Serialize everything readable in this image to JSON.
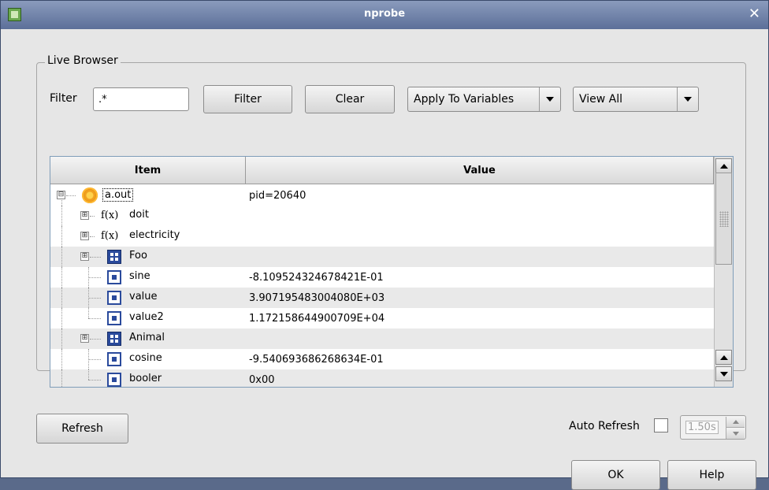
{
  "window": {
    "title": "nprobe",
    "close_glyph": "✕",
    "app_icon": "nprobe-app-icon"
  },
  "group": {
    "legend": "Live Browser"
  },
  "filter": {
    "label": "Filter",
    "value": ".*",
    "filter_button": "Filter",
    "clear_button": "Clear",
    "apply_combo": "Apply To Variables",
    "view_combo": "View All"
  },
  "tree": {
    "columns": [
      "Item",
      "Value"
    ],
    "rows": [
      {
        "label": "a.out",
        "value": "pid=20640",
        "icon": "process-gear-icon",
        "expander": "⊟"
      },
      {
        "label": "doit",
        "value": "",
        "icon": "function-icon",
        "icon_text": "f(x)",
        "expander": "⊞"
      },
      {
        "label": "electricity",
        "value": "",
        "icon": "function-icon",
        "icon_text": "f(x)",
        "expander": "⊞"
      },
      {
        "label": "Foo",
        "value": "",
        "icon": "struct-icon",
        "expander": "⊞"
      },
      {
        "label": "sine",
        "value": "-8.109524324678421E-01",
        "icon": "variable-icon"
      },
      {
        "label": "value",
        "value": "3.907195483004080E+03",
        "icon": "variable-icon"
      },
      {
        "label": "value2",
        "value": "1.172158644900709E+04",
        "icon": "variable-icon"
      },
      {
        "label": "Animal",
        "value": "",
        "icon": "struct-icon",
        "expander": "⊞"
      },
      {
        "label": "cosine",
        "value": "-9.540693686268634E-01",
        "icon": "variable-icon"
      },
      {
        "label": "booler",
        "value": "0x00",
        "icon": "variable-icon"
      }
    ]
  },
  "footer": {
    "refresh_button": "Refresh",
    "auto_refresh_label": "Auto Refresh",
    "auto_refresh_checked": false,
    "interval_value": "1.50s",
    "ok_button": "OK",
    "help_button": "Help"
  }
}
